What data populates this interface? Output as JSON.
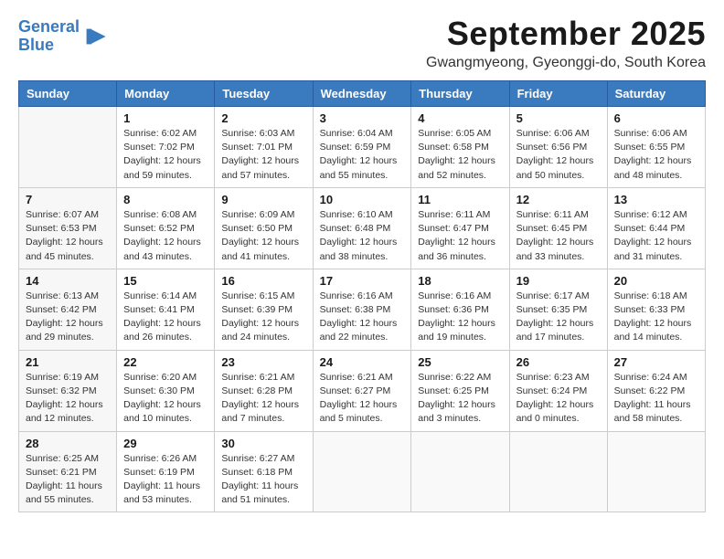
{
  "logo": {
    "line1": "General",
    "line2": "Blue"
  },
  "title": "September 2025",
  "subtitle": "Gwangmyeong, Gyeonggi-do, South Korea",
  "weekdays": [
    "Sunday",
    "Monday",
    "Tuesday",
    "Wednesday",
    "Thursday",
    "Friday",
    "Saturday"
  ],
  "weeks": [
    [
      {
        "day": "",
        "info": ""
      },
      {
        "day": "1",
        "info": "Sunrise: 6:02 AM\nSunset: 7:02 PM\nDaylight: 12 hours\nand 59 minutes."
      },
      {
        "day": "2",
        "info": "Sunrise: 6:03 AM\nSunset: 7:01 PM\nDaylight: 12 hours\nand 57 minutes."
      },
      {
        "day": "3",
        "info": "Sunrise: 6:04 AM\nSunset: 6:59 PM\nDaylight: 12 hours\nand 55 minutes."
      },
      {
        "day": "4",
        "info": "Sunrise: 6:05 AM\nSunset: 6:58 PM\nDaylight: 12 hours\nand 52 minutes."
      },
      {
        "day": "5",
        "info": "Sunrise: 6:06 AM\nSunset: 6:56 PM\nDaylight: 12 hours\nand 50 minutes."
      },
      {
        "day": "6",
        "info": "Sunrise: 6:06 AM\nSunset: 6:55 PM\nDaylight: 12 hours\nand 48 minutes."
      }
    ],
    [
      {
        "day": "7",
        "info": "Sunrise: 6:07 AM\nSunset: 6:53 PM\nDaylight: 12 hours\nand 45 minutes."
      },
      {
        "day": "8",
        "info": "Sunrise: 6:08 AM\nSunset: 6:52 PM\nDaylight: 12 hours\nand 43 minutes."
      },
      {
        "day": "9",
        "info": "Sunrise: 6:09 AM\nSunset: 6:50 PM\nDaylight: 12 hours\nand 41 minutes."
      },
      {
        "day": "10",
        "info": "Sunrise: 6:10 AM\nSunset: 6:48 PM\nDaylight: 12 hours\nand 38 minutes."
      },
      {
        "day": "11",
        "info": "Sunrise: 6:11 AM\nSunset: 6:47 PM\nDaylight: 12 hours\nand 36 minutes."
      },
      {
        "day": "12",
        "info": "Sunrise: 6:11 AM\nSunset: 6:45 PM\nDaylight: 12 hours\nand 33 minutes."
      },
      {
        "day": "13",
        "info": "Sunrise: 6:12 AM\nSunset: 6:44 PM\nDaylight: 12 hours\nand 31 minutes."
      }
    ],
    [
      {
        "day": "14",
        "info": "Sunrise: 6:13 AM\nSunset: 6:42 PM\nDaylight: 12 hours\nand 29 minutes."
      },
      {
        "day": "15",
        "info": "Sunrise: 6:14 AM\nSunset: 6:41 PM\nDaylight: 12 hours\nand 26 minutes."
      },
      {
        "day": "16",
        "info": "Sunrise: 6:15 AM\nSunset: 6:39 PM\nDaylight: 12 hours\nand 24 minutes."
      },
      {
        "day": "17",
        "info": "Sunrise: 6:16 AM\nSunset: 6:38 PM\nDaylight: 12 hours\nand 22 minutes."
      },
      {
        "day": "18",
        "info": "Sunrise: 6:16 AM\nSunset: 6:36 PM\nDaylight: 12 hours\nand 19 minutes."
      },
      {
        "day": "19",
        "info": "Sunrise: 6:17 AM\nSunset: 6:35 PM\nDaylight: 12 hours\nand 17 minutes."
      },
      {
        "day": "20",
        "info": "Sunrise: 6:18 AM\nSunset: 6:33 PM\nDaylight: 12 hours\nand 14 minutes."
      }
    ],
    [
      {
        "day": "21",
        "info": "Sunrise: 6:19 AM\nSunset: 6:32 PM\nDaylight: 12 hours\nand 12 minutes."
      },
      {
        "day": "22",
        "info": "Sunrise: 6:20 AM\nSunset: 6:30 PM\nDaylight: 12 hours\nand 10 minutes."
      },
      {
        "day": "23",
        "info": "Sunrise: 6:21 AM\nSunset: 6:28 PM\nDaylight: 12 hours\nand 7 minutes."
      },
      {
        "day": "24",
        "info": "Sunrise: 6:21 AM\nSunset: 6:27 PM\nDaylight: 12 hours\nand 5 minutes."
      },
      {
        "day": "25",
        "info": "Sunrise: 6:22 AM\nSunset: 6:25 PM\nDaylight: 12 hours\nand 3 minutes."
      },
      {
        "day": "26",
        "info": "Sunrise: 6:23 AM\nSunset: 6:24 PM\nDaylight: 12 hours\nand 0 minutes."
      },
      {
        "day": "27",
        "info": "Sunrise: 6:24 AM\nSunset: 6:22 PM\nDaylight: 11 hours\nand 58 minutes."
      }
    ],
    [
      {
        "day": "28",
        "info": "Sunrise: 6:25 AM\nSunset: 6:21 PM\nDaylight: 11 hours\nand 55 minutes."
      },
      {
        "day": "29",
        "info": "Sunrise: 6:26 AM\nSunset: 6:19 PM\nDaylight: 11 hours\nand 53 minutes."
      },
      {
        "day": "30",
        "info": "Sunrise: 6:27 AM\nSunset: 6:18 PM\nDaylight: 11 hours\nand 51 minutes."
      },
      {
        "day": "",
        "info": ""
      },
      {
        "day": "",
        "info": ""
      },
      {
        "day": "",
        "info": ""
      },
      {
        "day": "",
        "info": ""
      }
    ]
  ]
}
